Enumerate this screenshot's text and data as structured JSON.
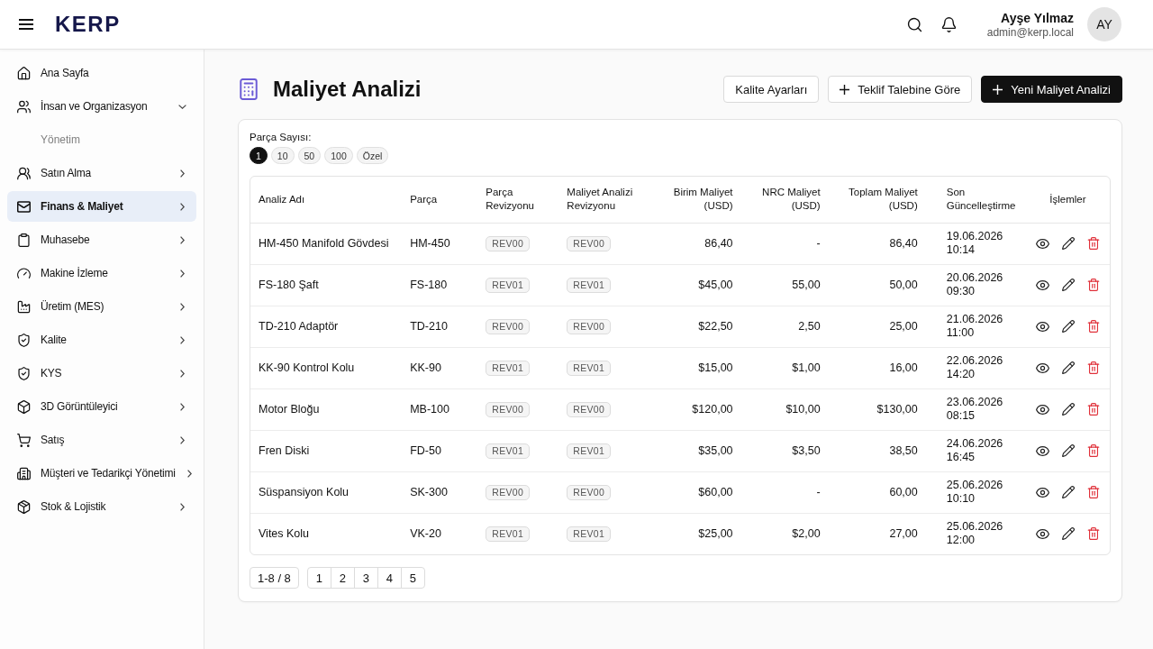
{
  "topbar": {
    "logo": "KERP",
    "user": {
      "name": "Ayşe Yılmaz",
      "email": "admin@kerp.local",
      "initials": "AY"
    }
  },
  "sidebar": {
    "items": [
      {
        "label": "Ana Sayfa",
        "kind": "link",
        "selected": false
      },
      {
        "label": "İnsan ve Organizasyon",
        "kind": "group",
        "selected": false,
        "expanded": true,
        "children": [
          {
            "label": "Yönetim",
            "selected": false
          }
        ]
      },
      {
        "label": "Satın Alma",
        "kind": "group",
        "selected": false,
        "expanded": false
      },
      {
        "label": "Finans & Maliyet",
        "kind": "group",
        "selected": true,
        "expanded": false
      },
      {
        "label": "Muhasebe",
        "kind": "group",
        "selected": false,
        "expanded": false
      },
      {
        "label": "Makine İzleme",
        "kind": "group",
        "selected": false,
        "expanded": false
      },
      {
        "label": "Üretim (MES)",
        "kind": "group",
        "selected": false,
        "expanded": false
      },
      {
        "label": "Kalite",
        "kind": "group",
        "selected": false,
        "expanded": false
      },
      {
        "label": "KYS",
        "kind": "group",
        "selected": false,
        "expanded": false
      },
      {
        "label": "3D Görüntüleyici",
        "kind": "group",
        "selected": false,
        "expanded": false
      },
      {
        "label": "Satış",
        "kind": "group",
        "selected": false,
        "expanded": false
      },
      {
        "label": "Müşteri ve Tedarikçi Yönetimi",
        "kind": "group",
        "selected": false,
        "expanded": false
      },
      {
        "label": "Stok & Lojistik",
        "kind": "group",
        "selected": false,
        "expanded": false
      }
    ]
  },
  "page": {
    "title": "Maliyet Analizi",
    "actions": [
      {
        "label": "Kalite Ayarları",
        "kind": "secondary"
      },
      {
        "label": "Teklif Talebine Göre",
        "kind": "secondary-add"
      },
      {
        "label": "Yeni Maliyet Analizi",
        "kind": "primary-add"
      }
    ]
  },
  "part_count": {
    "label": "Parça Sayısı:",
    "options": [
      {
        "label": "1",
        "selected": true
      },
      {
        "label": "10",
        "selected": false
      },
      {
        "label": "50",
        "selected": false
      },
      {
        "label": "100",
        "selected": false
      },
      {
        "label": "Özel",
        "selected": false
      }
    ]
  },
  "table": {
    "columns": [
      "Analiz Adı",
      "Parça",
      "Parça Revizyonu",
      "Maliyet Analizi Revizyonu",
      "Birim Maliyet (USD)",
      "NRC Maliyet (USD)",
      "Toplam Maliyet (USD)",
      "Son Güncelleştirme",
      "İşlemler"
    ],
    "rows": [
      {
        "name": "HM-450 Manifold Gövdesi",
        "part": "HM-450",
        "part_revision": "REV00",
        "analysis_revision": "REV00",
        "unit_cost": "86,40",
        "nrc_cost": "-",
        "total_cost": "86,40",
        "updated": "19.06.2026 10:14"
      },
      {
        "name": "FS-180 Şaft",
        "part": "FS-180",
        "part_revision": "REV01",
        "analysis_revision": "REV01",
        "unit_cost": "$45,00",
        "nrc_cost": "55,00",
        "total_cost": "50,00",
        "updated": "20.06.2026 09:30"
      },
      {
        "name": "TD-210 Adaptör",
        "part": "TD-210",
        "part_revision": "REV00",
        "analysis_revision": "REV00",
        "unit_cost": "$22,50",
        "nrc_cost": "2,50",
        "total_cost": "25,00",
        "updated": "21.06.2026 11:00"
      },
      {
        "name": "KK-90 Kontrol Kolu",
        "part": "KK-90",
        "part_revision": "REV01",
        "analysis_revision": "REV01",
        "unit_cost": "$15,00",
        "nrc_cost": "$1,00",
        "total_cost": "16,00",
        "updated": "22.06.2026 14:20"
      },
      {
        "name": "Motor Bloğu",
        "part": "MB-100",
        "part_revision": "REV00",
        "analysis_revision": "REV00",
        "unit_cost": "$120,00",
        "nrc_cost": "$10,00",
        "total_cost": "$130,00",
        "updated": "23.06.2026 08:15"
      },
      {
        "name": "Fren Diski",
        "part": "FD-50",
        "part_revision": "REV01",
        "analysis_revision": "REV01",
        "unit_cost": "$35,00",
        "nrc_cost": "$3,50",
        "total_cost": "38,50",
        "updated": "24.06.2026 16:45"
      },
      {
        "name": "Süspansiyon Kolu",
        "part": "SK-300",
        "part_revision": "REV00",
        "analysis_revision": "REV00",
        "unit_cost": "$60,00",
        "nrc_cost": "-",
        "total_cost": "60,00",
        "updated": "25.06.2026 10:10"
      },
      {
        "name": "Vites Kolu",
        "part": "VK-20",
        "part_revision": "REV01",
        "analysis_revision": "REV01",
        "unit_cost": "$25,00",
        "nrc_cost": "$2,00",
        "total_cost": "27,00",
        "updated": "25.06.2026 12:00"
      }
    ]
  },
  "pagination": {
    "range": "1-8 / 8",
    "pages": [
      "1",
      "2",
      "3",
      "4",
      "5"
    ]
  }
}
